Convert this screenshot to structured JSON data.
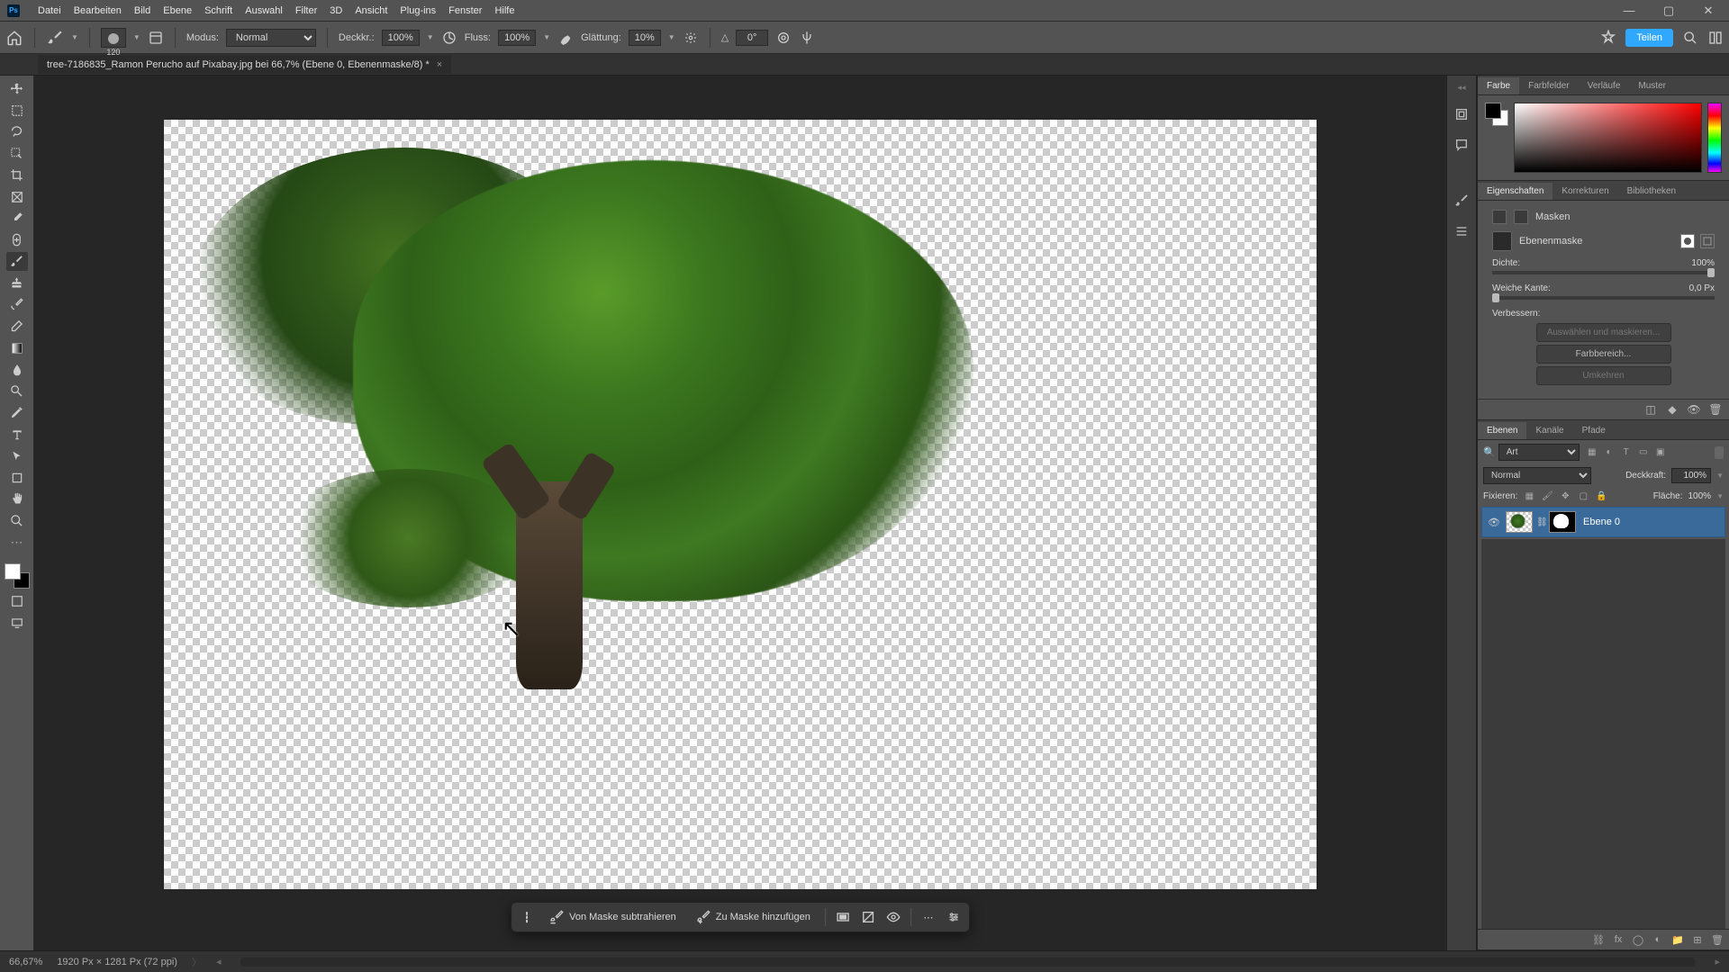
{
  "menu": {
    "items": [
      "Datei",
      "Bearbeiten",
      "Bild",
      "Ebene",
      "Schrift",
      "Auswahl",
      "Filter",
      "3D",
      "Ansicht",
      "Plug-ins",
      "Fenster",
      "Hilfe"
    ]
  },
  "options": {
    "brush_size": "120",
    "mode_label": "Modus:",
    "mode_value": "Normal",
    "opacity_label": "Deckkr.:",
    "opacity_value": "100%",
    "flow_label": "Fluss:",
    "flow_value": "100%",
    "smoothing_label": "Glättung:",
    "smoothing_value": "10%",
    "angle_icon": "△",
    "angle_value": "0°",
    "share_label": "Teilen"
  },
  "document": {
    "tab_title": "tree-7186835_Ramon Perucho auf Pixabay.jpg bei 66,7% (Ebene 0, Ebenenmaske/8) *"
  },
  "context_toolbar": {
    "subtract": "Von Maske subtrahieren",
    "add": "Zu Maske hinzufügen"
  },
  "panels": {
    "color": {
      "tabs": [
        "Farbe",
        "Farbfelder",
        "Verläufe",
        "Muster"
      ]
    },
    "properties": {
      "tabs": [
        "Eigenschaften",
        "Korrekturen",
        "Bibliotheken"
      ],
      "section_title": "Masken",
      "mask_type": "Ebenenmaske",
      "density_label": "Dichte:",
      "density_value": "100%",
      "feather_label": "Weiche Kante:",
      "feather_value": "0,0 Px",
      "refine_label": "Verbessern:",
      "btn_select_mask": "Auswählen und maskieren...",
      "btn_color_range": "Farbbereich...",
      "btn_invert": "Umkehren"
    },
    "layers": {
      "tabs": [
        "Ebenen",
        "Kanäle",
        "Pfade"
      ],
      "filter_label": "Art",
      "blend_mode": "Normal",
      "opacity_label": "Deckkraft:",
      "opacity_value": "100%",
      "lock_label": "Fixieren:",
      "fill_label": "Fläche:",
      "fill_value": "100%",
      "layer0_name": "Ebene 0"
    }
  },
  "status": {
    "zoom": "66,67%",
    "doc_info": "1920 Px × 1281 Px (72 ppi)"
  }
}
